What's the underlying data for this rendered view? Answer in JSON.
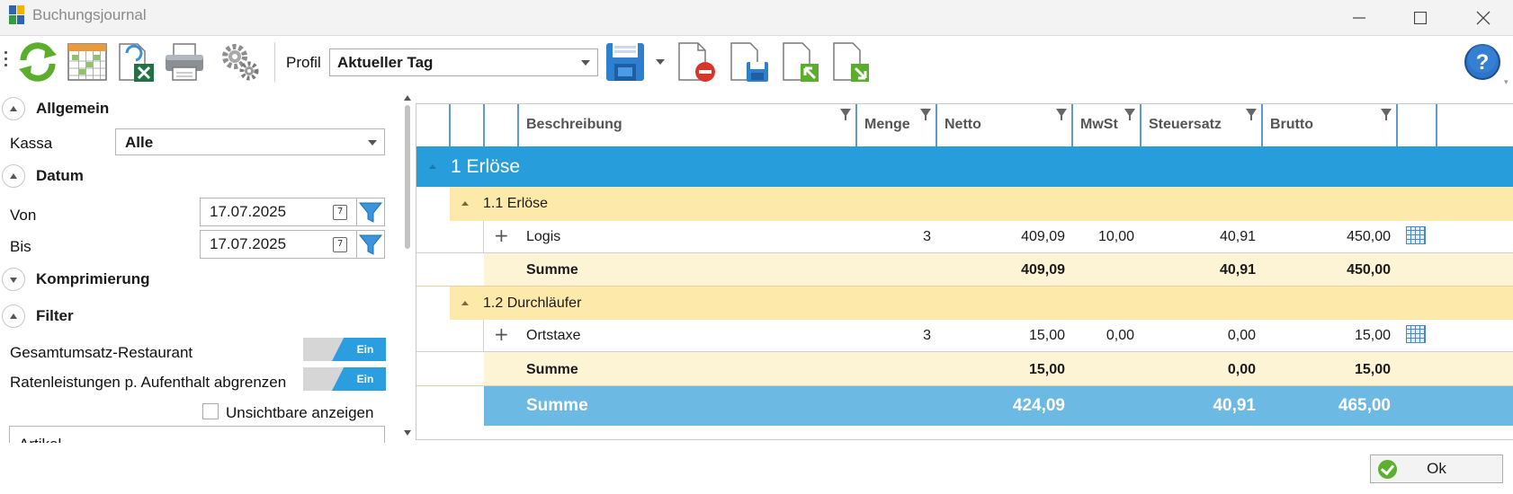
{
  "window": {
    "title": "Buchungsjournal"
  },
  "toolbar": {
    "profil_label": "Profil",
    "profil_value": "Aktueller Tag",
    "buttons": [
      "refresh-icon",
      "calendar-grid-icon",
      "export-excel-icon",
      "print-icon",
      "settings-gears-icon",
      "save-disk-icon",
      "delete-file-icon",
      "save-file-icon",
      "import-file-icon",
      "export-file-icon",
      "help-icon"
    ]
  },
  "left": {
    "allgemein": "Allgemein",
    "kassa_label": "Kassa",
    "kassa_value": "Alle",
    "datum": "Datum",
    "von_label": "Von",
    "von_value": "17.07.2025",
    "bis_label": "Bis",
    "bis_value": "17.07.2025",
    "komprimierung": "Komprimierung",
    "filter": "Filter",
    "toggle1_label": "Gesamtumsatz-Restaurant",
    "toggle1_value": "Ein",
    "toggle2_label": "Ratenleistungen p. Aufenthalt abgrenzen",
    "toggle2_value": "Ein",
    "checkbox_label": "Unsichtbare anzeigen",
    "artikel_partial": "Artikel"
  },
  "grid": {
    "columns": [
      "Beschreibung",
      "Menge",
      "Netto",
      "MwSt",
      "Steuersatz",
      "Brutto"
    ],
    "group1": "1 Erlöse",
    "group1_1": "1.1 Erlöse",
    "row1": {
      "desc": "Logis",
      "menge": "3",
      "netto": "409,09",
      "mwst": "10,00",
      "steuer": "40,91",
      "brutto": "450,00"
    },
    "sum1": {
      "label": "Summe",
      "netto": "409,09",
      "steuer": "40,91",
      "brutto": "450,00"
    },
    "group1_2": "1.2 Durchläufer",
    "row2": {
      "desc": "Ortstaxe",
      "menge": "3",
      "netto": "15,00",
      "mwst": "0,00",
      "steuer": "0,00",
      "brutto": "15,00"
    },
    "sum2": {
      "label": "Summe",
      "netto": "15,00",
      "steuer": "0,00",
      "brutto": "15,00"
    },
    "total": {
      "label": "Summe",
      "netto": "424,09",
      "steuer": "40,91",
      "brutto": "465,00"
    }
  },
  "ok_label": "Ok"
}
